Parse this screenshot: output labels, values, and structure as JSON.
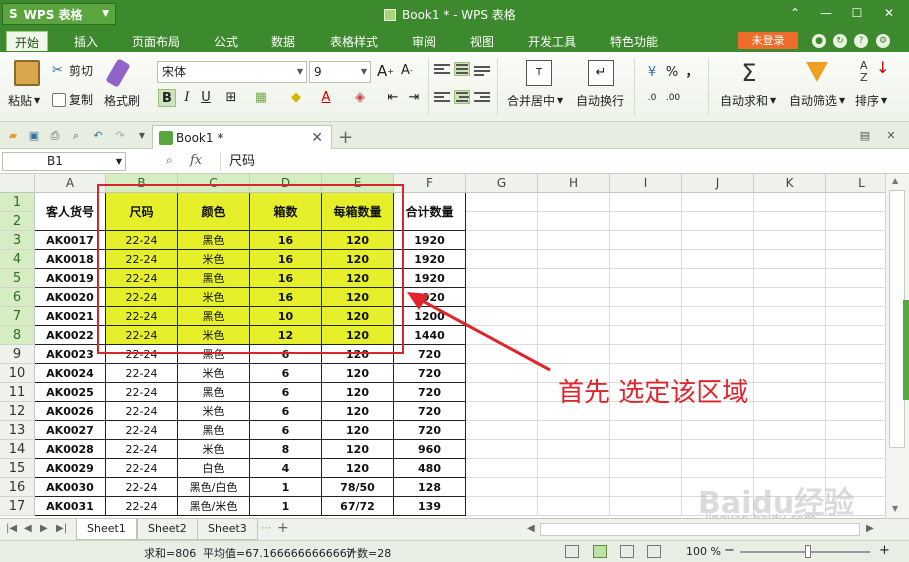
{
  "app": {
    "name": "WPS 表格",
    "logo": "S",
    "window_title": "Book1 * - WPS 表格"
  },
  "menu": {
    "tabs": [
      "开始",
      "插入",
      "页面布局",
      "公式",
      "数据",
      "表格样式",
      "审阅",
      "视图",
      "开发工具",
      "特色功能"
    ],
    "login": "未登录"
  },
  "ribbon": {
    "paste": "粘贴",
    "cut": "剪切",
    "copy": "复制",
    "format_painter": "格式刷",
    "font_name": "宋体",
    "font_size": "9",
    "merge_center": "合并居中",
    "wrap_text": "自动换行",
    "auto_sum": "自动求和",
    "auto_filter": "自动筛选",
    "sort": "排序",
    "percent": "%",
    "comma": "，"
  },
  "document_tab": {
    "label": "Book1 *"
  },
  "formula_bar": {
    "cell_ref": "B1",
    "fx": "fx",
    "content": "尺码"
  },
  "columns": [
    "A",
    "B",
    "C",
    "D",
    "E",
    "F",
    "G",
    "H",
    "I",
    "J",
    "K",
    "L"
  ],
  "rows": [
    "1",
    "2",
    "3",
    "4",
    "5",
    "6",
    "7",
    "8",
    "9",
    "10",
    "11",
    "12",
    "13",
    "14",
    "15",
    "16",
    "17"
  ],
  "table": {
    "headers": [
      "客人货号",
      "尺码",
      "颜色",
      "箱数",
      "每箱数量",
      "合计数量"
    ],
    "rows": [
      [
        "AK0017",
        "22-24",
        "黑色",
        "16",
        "120",
        "1920"
      ],
      [
        "AK0018",
        "22-24",
        "米色",
        "16",
        "120",
        "1920"
      ],
      [
        "AK0019",
        "22-24",
        "黑色",
        "16",
        "120",
        "1920"
      ],
      [
        "AK0020",
        "22-24",
        "米色",
        "16",
        "120",
        "1920"
      ],
      [
        "AK0021",
        "22-24",
        "黑色",
        "10",
        "120",
        "1200"
      ],
      [
        "AK0022",
        "22-24",
        "米色",
        "12",
        "120",
        "1440"
      ],
      [
        "AK0023",
        "22-24",
        "黑色",
        "6",
        "120",
        "720"
      ],
      [
        "AK0024",
        "22-24",
        "米色",
        "6",
        "120",
        "720"
      ],
      [
        "AK0025",
        "22-24",
        "黑色",
        "6",
        "120",
        "720"
      ],
      [
        "AK0026",
        "22-24",
        "米色",
        "6",
        "120",
        "720"
      ],
      [
        "AK0027",
        "22-24",
        "黑色",
        "6",
        "120",
        "720"
      ],
      [
        "AK0028",
        "22-24",
        "米色",
        "8",
        "120",
        "960"
      ],
      [
        "AK0029",
        "22-24",
        "白色",
        "4",
        "120",
        "480"
      ],
      [
        "AK0030",
        "22-24",
        "黑色/白色",
        "1",
        "78/50",
        "128"
      ],
      [
        "AK0031",
        "22-24",
        "黑色/米色",
        "1",
        "67/72",
        "139"
      ]
    ]
  },
  "annotation": "首先 选定该区域",
  "sheets": [
    "Sheet1",
    "Sheet2",
    "Sheet3"
  ],
  "status": {
    "sum": "求和=806",
    "average": "平均值=67.1666666666667",
    "count": "计数=28",
    "zoom": "100 %"
  },
  "watermark": {
    "brand": "Baidu经验",
    "url": "jingyan.baidu.com"
  },
  "colors": {
    "title_green": "#3d8a2e",
    "highlight_yellow": "#e6f02a",
    "selection_red": "#d9262a",
    "login_orange": "#ef6b2a"
  }
}
